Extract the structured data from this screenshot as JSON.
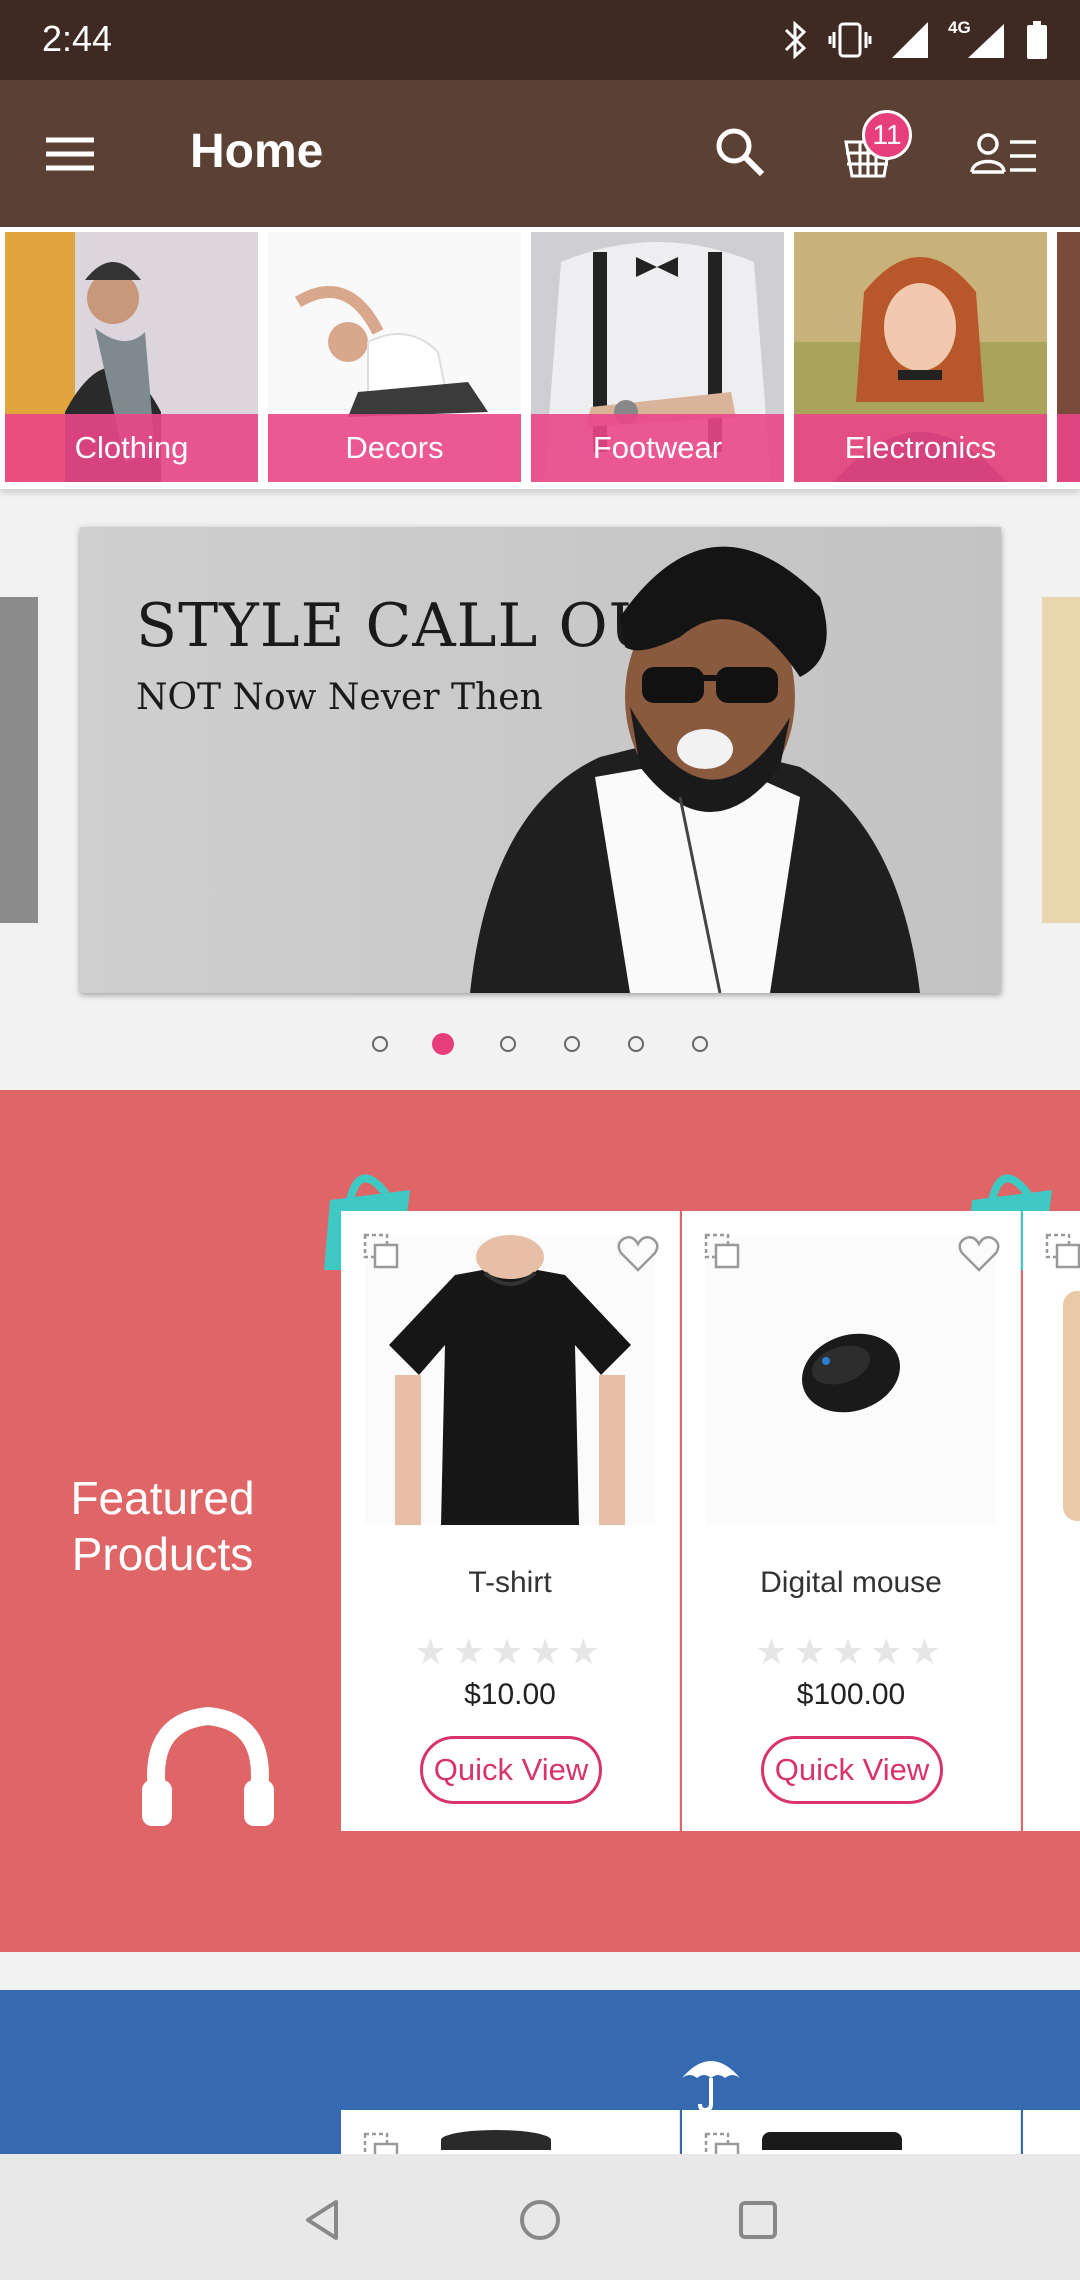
{
  "status_bar": {
    "time": "2:44",
    "network": "4G"
  },
  "app_bar": {
    "title": "Home",
    "cart_count": "11"
  },
  "categories": [
    {
      "label": "Clothing"
    },
    {
      "label": "Decors"
    },
    {
      "label": "Footwear"
    },
    {
      "label": "Electronics"
    }
  ],
  "banner": {
    "title": "STYLE CALL OUT",
    "subtitle": "NOT Now Never Then",
    "slide_count": 6,
    "active_slide": 2
  },
  "featured": {
    "title": "Featured Products",
    "products": [
      {
        "name": "T-shirt",
        "price": "$10.00",
        "rating": 0,
        "action": "Quick View"
      },
      {
        "name": "Digital mouse",
        "price": "$100.00",
        "rating": 0,
        "action": "Quick View"
      }
    ]
  },
  "colors": {
    "status_bar": "#3e2a22",
    "app_bar": "#5b4034",
    "accent": "#e63f7b",
    "featured_bg": "#e06566",
    "second_section_bg": "#3569b0"
  },
  "icons": [
    "menu-icon",
    "search-icon",
    "cart-icon",
    "account-icon",
    "compare-icon",
    "heart-icon",
    "headphones-icon",
    "shopping-bag-icon",
    "umbrella-icon",
    "back-icon",
    "home-icon",
    "recents-icon"
  ]
}
